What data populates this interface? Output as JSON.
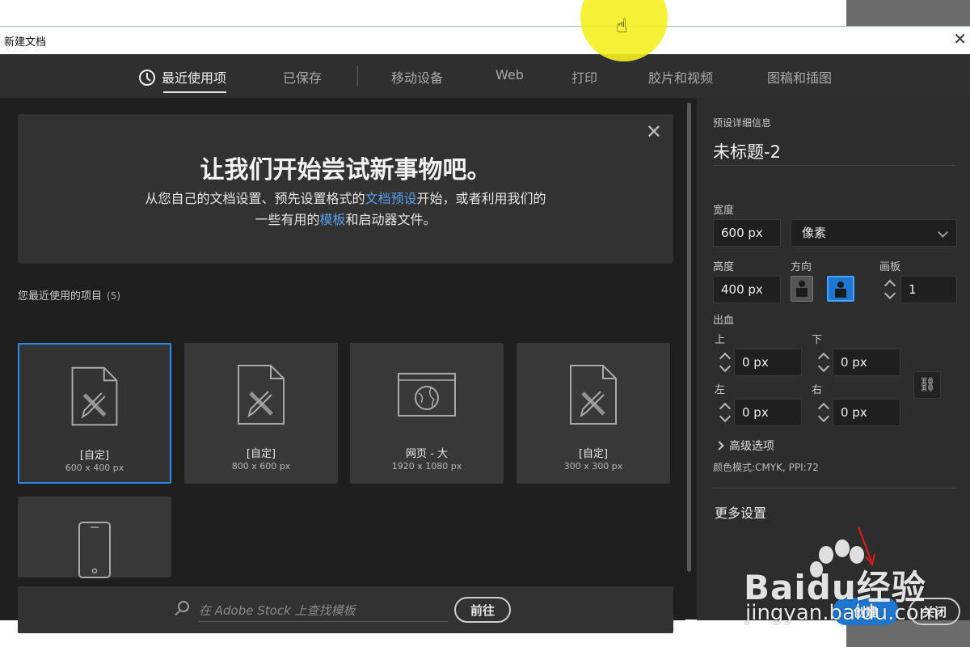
{
  "window": {
    "title": "新建文档"
  },
  "tabs": [
    {
      "label": "最近使用项"
    },
    {
      "label": "已保存"
    },
    {
      "label": "移动设备"
    },
    {
      "label": "Web"
    },
    {
      "label": "打印"
    },
    {
      "label": "胶片和视频"
    },
    {
      "label": "图稿和插图"
    }
  ],
  "welcome": {
    "headline": "让我们开始尝试新事物吧。",
    "line1_a": "从您自己的文档设置、预先设置格式的",
    "line1_link": "文档预设",
    "line1_b": "开始，或者利用我们的",
    "line2_a": "一些有用的",
    "line2_link": "模板",
    "line2_b": "和启动器文件。"
  },
  "recent": {
    "label": "您最近使用的项目",
    "count": "(5)",
    "items": [
      {
        "name": "[自定]",
        "size": "600 x 400 px",
        "icon": "document-pencil-icon"
      },
      {
        "name": "[自定]",
        "size": "800 x 600 px",
        "icon": "document-pencil-icon"
      },
      {
        "name": "网页 - 大",
        "size": "1920 x 1080 px",
        "icon": "web-globe-icon"
      },
      {
        "name": "[自定]",
        "size": "300 x 300 px",
        "icon": "document-pencil-icon"
      },
      {
        "name": "",
        "size": "",
        "icon": "mobile-phone-icon"
      }
    ]
  },
  "search": {
    "placeholder": "在 Adobe Stock 上查找模板",
    "go_label": "前往"
  },
  "preset": {
    "section_label": "预设详细信息",
    "doc_name": "未标题-2",
    "width_label": "宽度",
    "width_value": "600 px",
    "unit_value": "像素",
    "height_label": "高度",
    "height_value": "400 px",
    "orientation_label": "方向",
    "artboards_label": "画板",
    "artboards_value": "1",
    "bleed_label": "出血",
    "top_label": "上",
    "bottom_label": "下",
    "left_label": "左",
    "right_label": "右",
    "top_value": "0 px",
    "bottom_value": "0 px",
    "left_value": "0 px",
    "right_value": "0 px",
    "advanced_label": "高级选项",
    "color_mode": "颜色模式:CMYK, PPI:72",
    "more_settings": "更多设置",
    "create_label": "创建",
    "close_label": "关闭"
  },
  "watermark": {
    "brand": "Baidu经验",
    "url": "jingyan.baidu.com"
  },
  "colors": {
    "accent": "#1e78d2",
    "selection": "#2d8ceb",
    "link": "#5aa0e8",
    "panel": "#2d2d2d",
    "background": "#1f1f1f"
  }
}
